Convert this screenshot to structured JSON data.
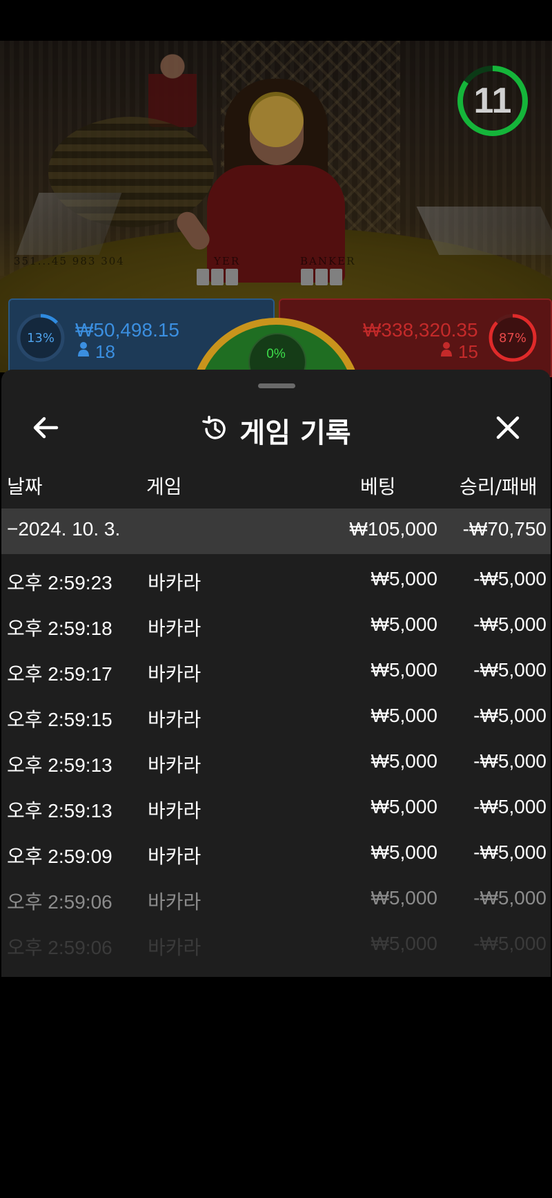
{
  "video": {
    "timer": "11",
    "table_text_player": "YER",
    "table_text_banker": "BANKER",
    "table_text_left": "351...45 983 304"
  },
  "bets": {
    "player": {
      "pct": "13%",
      "amount": "₩50,498.15",
      "count": "18"
    },
    "tie": {
      "pct": "0%"
    },
    "banker": {
      "pct": "87%",
      "amount": "₩338,320.35",
      "count": "15"
    }
  },
  "sheet": {
    "title": "게임 기록",
    "columns": {
      "date": "날짜",
      "game": "게임",
      "bet": "베팅",
      "winloss": "승리/패배"
    },
    "date_group": {
      "label": "−2024. 10. 3.",
      "bet": "₩105,000",
      "winloss": "-₩70,750"
    },
    "rows": [
      {
        "time": "오후 2:59:23",
        "game": "바카라",
        "bet": "₩5,000",
        "winloss": "-₩5,000"
      },
      {
        "time": "오후 2:59:18",
        "game": "바카라",
        "bet": "₩5,000",
        "winloss": "-₩5,000"
      },
      {
        "time": "오후 2:59:17",
        "game": "바카라",
        "bet": "₩5,000",
        "winloss": "-₩5,000"
      },
      {
        "time": "오후 2:59:15",
        "game": "바카라",
        "bet": "₩5,000",
        "winloss": "-₩5,000"
      },
      {
        "time": "오후 2:59:13",
        "game": "바카라",
        "bet": "₩5,000",
        "winloss": "-₩5,000"
      },
      {
        "time": "오후 2:59:13",
        "game": "바카라",
        "bet": "₩5,000",
        "winloss": "-₩5,000"
      },
      {
        "time": "오후 2:59:09",
        "game": "바카라",
        "bet": "₩5,000",
        "winloss": "-₩5,000"
      },
      {
        "time": "오후 2:59:06",
        "game": "바카라",
        "bet": "₩5,000",
        "winloss": "-₩5,000"
      },
      {
        "time": "오후 2:59:06",
        "game": "바카라",
        "bet": "₩5,000",
        "winloss": "-₩5,000"
      }
    ]
  },
  "icons": {
    "back": "arrow-left-icon",
    "history": "history-icon",
    "close": "close-icon",
    "person": "person-icon"
  }
}
